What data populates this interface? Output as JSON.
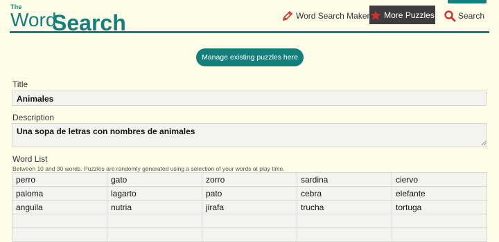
{
  "header": {
    "logo_the": "The",
    "logo_word": "Word",
    "logo_search": "Search",
    "nav": {
      "maker_label": "Word Search Maker",
      "more_label": "More Puzzles",
      "search_label": "Search"
    }
  },
  "manage_button_label": "Manage existing puzzles here",
  "form": {
    "title_label": "Title",
    "title_value": "Animales",
    "description_label": "Description",
    "description_value": "Una sopa de letras con nombres de animales",
    "wordlist_label": "Word List",
    "wordlist_hint": "Between 10 and 30 words. Puzzles are randomly generated using a selection of your words at play time.",
    "words": [
      [
        "perro",
        "gato",
        "zorro",
        "sardina",
        "ciervo"
      ],
      [
        "paloma",
        "lagarto",
        "pato",
        "cebra",
        "elefante"
      ],
      [
        "anguila",
        "nutria",
        "jirafa",
        "trucha",
        "tortuga"
      ],
      [
        "",
        "",
        "",
        "",
        ""
      ],
      [
        "",
        "",
        "",
        "",
        ""
      ]
    ]
  },
  "colors": {
    "brand": "#137f7c",
    "background": "#fdfde8",
    "nav_active": "#3d3d3d",
    "icon_red": "#d32f2f"
  }
}
